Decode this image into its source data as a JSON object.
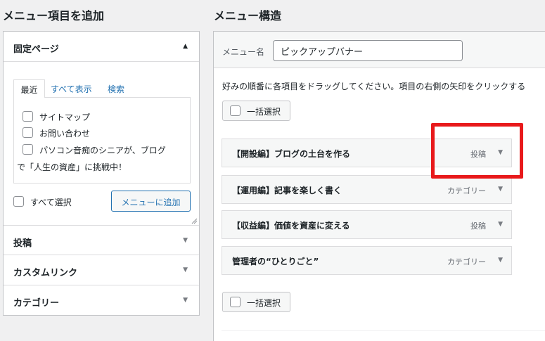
{
  "left": {
    "title": "メニュー項目を追加",
    "pages": {
      "header": "固定ページ",
      "tabs": [
        "最近",
        "すべて表示",
        "検索"
      ],
      "items": [
        "サイトマップ",
        "お問い合わせ",
        "パソコン音痴のシニアが、ブログ"
      ],
      "item3_cont": "で「人生の資産」に挑戦中！",
      "select_all": "すべて選択",
      "add_button": "メニューに追加"
    },
    "accordions": {
      "posts": "投稿",
      "custom_links": "カスタムリンク",
      "categories": "カテゴリー"
    }
  },
  "right": {
    "title": "メニュー構造",
    "menu_name_label": "メニュー名",
    "menu_name_value": "ピックアップバナー",
    "instructions": "好みの順番に各項目をドラッグしてください。項目の右側の矢印をクリックする",
    "bulk_select": "一括選択",
    "items": [
      {
        "title": "【開設編】ブログの土台を作る",
        "type": "投稿"
      },
      {
        "title": "【運用編】記事を楽しく書く",
        "type": "カテゴリー"
      },
      {
        "title": "【収益編】価値を資産に変える",
        "type": "投稿"
      },
      {
        "title": "管理者の“ひとりごと”",
        "type": "カテゴリー"
      }
    ]
  },
  "colors": {
    "accent": "#2271b1",
    "highlight": "#e8191b"
  },
  "icons": [
    "triangle-up-icon",
    "triangle-down-icon",
    "checkbox-icon",
    "resize-grip-icon"
  ]
}
